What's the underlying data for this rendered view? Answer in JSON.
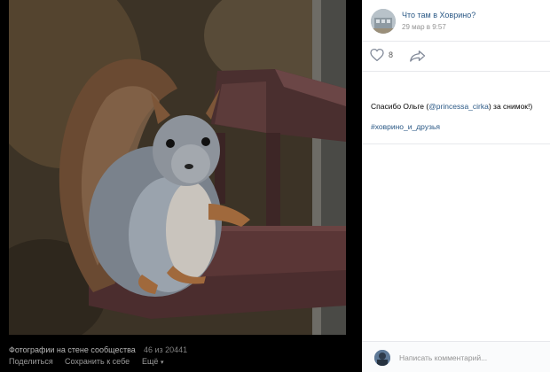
{
  "photo_footer": {
    "album_title": "Фотографии на стене сообщества",
    "counter": "46 из 20441",
    "share_label": "Поделиться",
    "save_label": "Сохранить к себе",
    "more_label": "Ещё",
    "more_icon": "chevron-down-icon"
  },
  "post": {
    "author": "Что там в Ховрино?",
    "date": "29 мар в 9:57",
    "likes": "8",
    "text_before": "Спасибо Ольге (",
    "mention": "@princessa_cirka",
    "text_after": ") за снимок!)",
    "hashtag": "#ховрино_и_друзья"
  },
  "comment": {
    "placeholder": "Написать комментарий..."
  },
  "colors": {
    "link": "#2a5885",
    "muted": "#939393",
    "footer_bg": "#000000"
  }
}
